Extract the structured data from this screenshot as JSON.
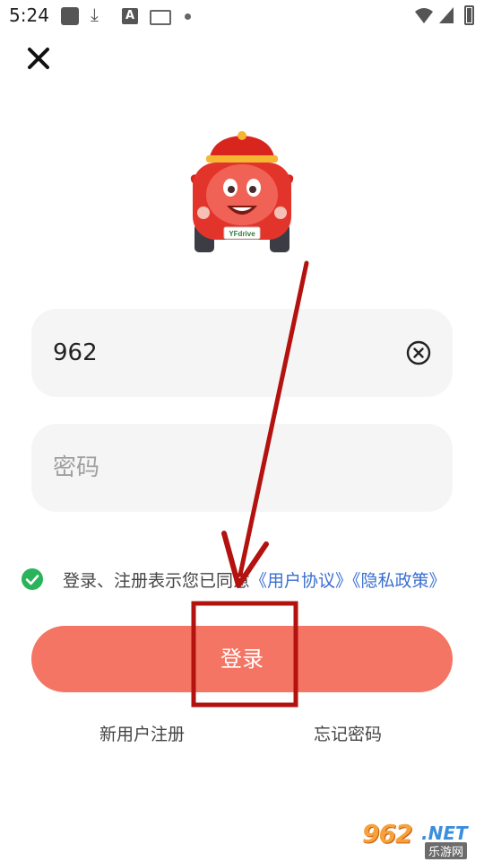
{
  "status_bar": {
    "time": "5:24",
    "icons": [
      "square-app-icon",
      "download-icon",
      "a-icon",
      "keyboard-icon",
      "dot-icon",
      "wifi-icon",
      "signal-icon",
      "battery-icon"
    ]
  },
  "header": {
    "close_icon": "close-icon"
  },
  "mascot": {
    "plate_text": "YFdrive"
  },
  "form": {
    "username_value": "962",
    "password_placeholder": "密码"
  },
  "agreement": {
    "checked": true,
    "prefix": "登录、注册表示您已同意",
    "user_agreement": "《用户协议》",
    "privacy_policy": "《隐私政策》"
  },
  "actions": {
    "login_label": "登录",
    "register_label": "新用户注册",
    "forgot_label": "忘记密码"
  },
  "watermark": {
    "number": "962",
    "net": ".NET",
    "sub": "乐游网"
  },
  "colors": {
    "accent": "#f47563",
    "link": "#3b6fd0",
    "check": "#29b35a",
    "annotation": "#b3120e"
  }
}
